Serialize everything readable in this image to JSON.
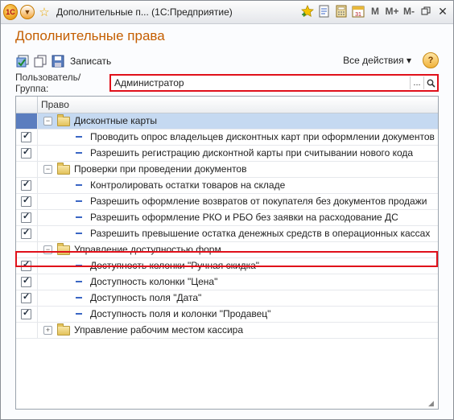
{
  "window": {
    "title": "Дополнительные п...  (1С:Предприятие)",
    "logo": "1С",
    "title_icons": [
      "menu-dropdown-icon",
      "favorite-star-icon",
      "add-favorite-icon",
      "document-icon",
      "calculator-icon",
      "calendar-icon",
      "memory-icon",
      "memory-plus-icon",
      "memory-minus-icon",
      "restore-icon",
      "close-icon"
    ],
    "mem_label": "M",
    "mem_plus_label": "M+",
    "mem_minus_label": "M-",
    "calendar_day": "31"
  },
  "form": {
    "title": "Дополнительные права"
  },
  "toolbar": {
    "save_label": "Записать",
    "all_actions_label": "Все действия ▾",
    "help_label": "?"
  },
  "user": {
    "label": "Пользователь/Группа:",
    "value": "Администратор",
    "select_label": "...",
    "search_label": "🔍"
  },
  "grid": {
    "column_header": "Право",
    "rows": [
      {
        "type": "group",
        "expanded": true,
        "checked": false,
        "selected": true,
        "label": "Дисконтные карты"
      },
      {
        "type": "leaf",
        "checked": true,
        "label": "Проводить опрос владельцев дисконтных карт при оформлении документов"
      },
      {
        "type": "leaf",
        "checked": true,
        "label": "Разрешить регистрацию дисконтной карты при считывании нового кода"
      },
      {
        "type": "group",
        "expanded": true,
        "checked": false,
        "label": "Проверки при проведении документов"
      },
      {
        "type": "leaf",
        "checked": true,
        "label": "Контролировать остатки товаров на складе"
      },
      {
        "type": "leaf",
        "checked": true,
        "label": "Разрешить оформление возвратов от покупателя без документов продажи"
      },
      {
        "type": "leaf",
        "checked": true,
        "label": "Разрешить оформление РКО и РБО без заявки на расходование ДС"
      },
      {
        "type": "leaf",
        "checked": true,
        "label": "Разрешить превышение остатка денежных средств в операционных кассах"
      },
      {
        "type": "group",
        "expanded": true,
        "checked": false,
        "label": "Управление доступностью форм"
      },
      {
        "type": "leaf",
        "checked": true,
        "label": "Доступность колонки \"Ручная скидка\""
      },
      {
        "type": "leaf",
        "checked": true,
        "label": "Доступность колонки \"Цена\""
      },
      {
        "type": "leaf",
        "checked": true,
        "label": "Доступность поля \"Дата\""
      },
      {
        "type": "leaf",
        "checked": true,
        "label": "Доступность поля и колонки \"Продавец\""
      },
      {
        "type": "group",
        "expanded": false,
        "checked": false,
        "label": "Управление рабочим местом кассира"
      }
    ]
  },
  "colors": {
    "title_accent": "#c45e00",
    "highlight_border": "#e0101a",
    "selection": "#c5d9f1"
  }
}
